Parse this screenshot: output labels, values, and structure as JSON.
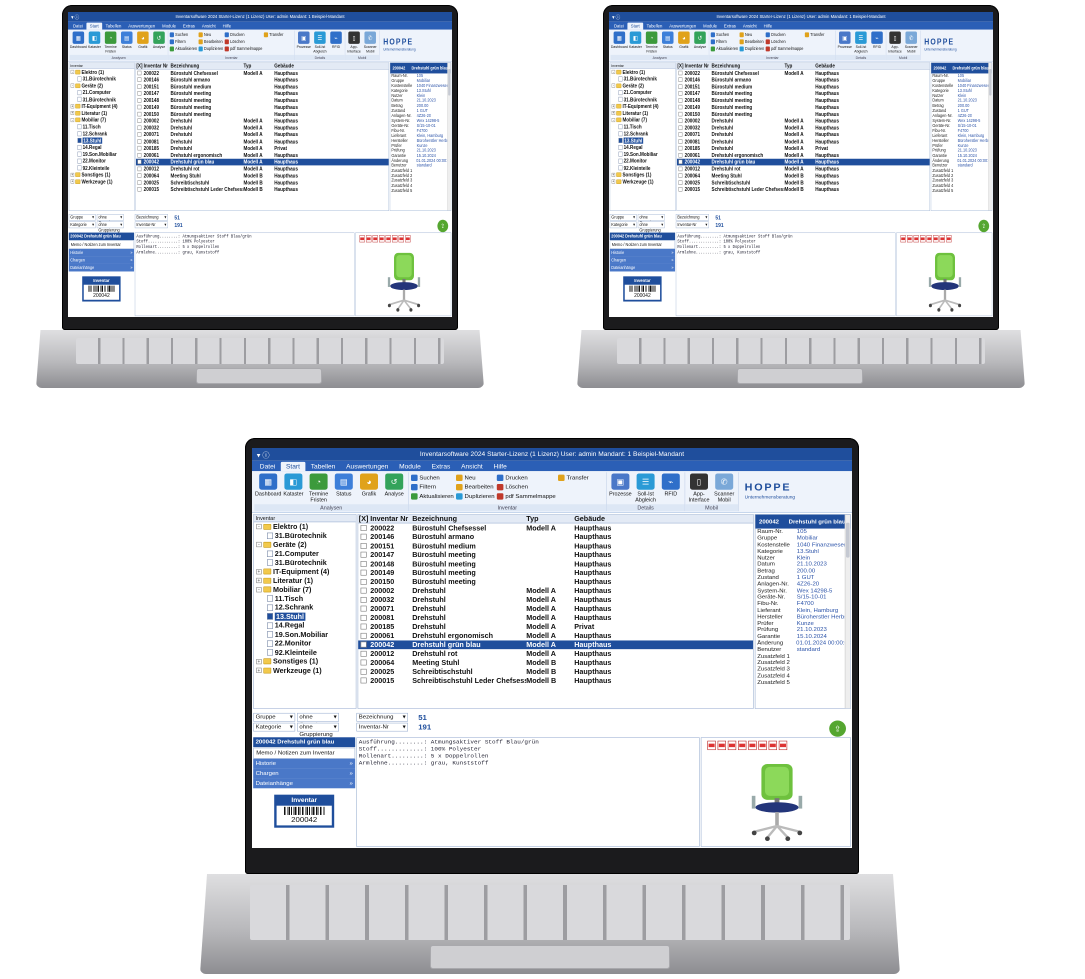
{
  "app": {
    "title": "Inventarsoftware 2024 Starter-Lizenz (1 Lizenz)   User: admin   Mandant: 1 Beispiel-Mandant",
    "menu": [
      "Datei",
      "Start",
      "Tabellen",
      "Auswertungen",
      "Module",
      "Extras",
      "Ansicht",
      "Hilfe"
    ],
    "active_menu": "Start"
  },
  "ribbon": {
    "analysen": {
      "label": "Analysen",
      "buttons": [
        "Dashboard",
        "Kataster",
        "Termine Fristen",
        "Status",
        "Grafik",
        "Analyse"
      ]
    },
    "inventar": {
      "label": "Inventar",
      "col1": [
        "Suchen",
        "Filtern",
        "Aktualisieren"
      ],
      "col2": [
        "Neu",
        "Bearbeiten",
        "Duplizieren"
      ],
      "col3": [
        "Drucken",
        "Löschen",
        "pdf Sammelmappe"
      ],
      "col4": [
        "Transfer"
      ]
    },
    "details": {
      "label": "Details",
      "buttons": [
        "Prozesse",
        "Soll-Ist Abgleich",
        "RFID"
      ]
    },
    "mobil": {
      "label": "Mobil",
      "buttons": [
        "App-Interface",
        "Scanner Mobil"
      ]
    },
    "brand": {
      "name": "HOPPE",
      "sub": "Unternehmensberatung"
    }
  },
  "tree": {
    "header": "Inventar",
    "nodes": [
      {
        "label": "Elektro  (1)",
        "level": 0,
        "type": "folder",
        "exp": "-"
      },
      {
        "label": "31.Bürotechnik",
        "level": 1,
        "type": "doc"
      },
      {
        "label": "Geräte  (2)",
        "level": 0,
        "type": "folder",
        "exp": "-"
      },
      {
        "label": "21.Computer",
        "level": 1,
        "type": "doc"
      },
      {
        "label": "31.Bürotechnik",
        "level": 1,
        "type": "doc"
      },
      {
        "label": "IT-Equipment  (4)",
        "level": 0,
        "type": "folder",
        "exp": "+"
      },
      {
        "label": "Literatur  (1)",
        "level": 0,
        "type": "folder",
        "exp": "+"
      },
      {
        "label": "Mobiliar  (7)",
        "level": 0,
        "type": "folder",
        "exp": "-"
      },
      {
        "label": "11.Tisch",
        "level": 1,
        "type": "doc"
      },
      {
        "label": "12.Schrank",
        "level": 1,
        "type": "doc"
      },
      {
        "label": "13.Stuhl",
        "level": 1,
        "type": "doc",
        "selected": true
      },
      {
        "label": "14.Regal",
        "level": 1,
        "type": "doc"
      },
      {
        "label": "19.Son.Mobiliar",
        "level": 1,
        "type": "doc"
      },
      {
        "label": "22.Monitor",
        "level": 1,
        "type": "doc"
      },
      {
        "label": "92.Kleinteile",
        "level": 1,
        "type": "doc"
      },
      {
        "label": "Sonstiges  (1)",
        "level": 0,
        "type": "folder",
        "exp": "+"
      },
      {
        "label": "Werkzeuge  (1)",
        "level": 0,
        "type": "folder",
        "exp": "+"
      }
    ]
  },
  "table": {
    "columns": [
      "[X]",
      "Inventar Nr",
      "Bezeichnung",
      "Typ",
      "Gebäude"
    ],
    "rows": [
      [
        "200022",
        "Bürostuhl Chefsessel",
        "Modell A",
        "Haupthaus"
      ],
      [
        "200146",
        "Bürostuhl armano",
        "",
        "Haupthaus"
      ],
      [
        "200151",
        "Bürostuhl medium",
        "",
        "Haupthaus"
      ],
      [
        "200147",
        "Bürostuhl meeting",
        "",
        "Haupthaus"
      ],
      [
        "200148",
        "Bürostuhl meeting",
        "",
        "Haupthaus"
      ],
      [
        "200149",
        "Bürostuhl meeting",
        "",
        "Haupthaus"
      ],
      [
        "200150",
        "Bürostuhl meeting",
        "",
        "Haupthaus"
      ],
      [
        "200002",
        "Drehstuhl",
        "Modell A",
        "Haupthaus"
      ],
      [
        "200032",
        "Drehstuhl",
        "Modell A",
        "Haupthaus"
      ],
      [
        "200071",
        "Drehstuhl",
        "Modell A",
        "Haupthaus"
      ],
      [
        "200081",
        "Drehstuhl",
        "Modell A",
        "Haupthaus"
      ],
      [
        "200185",
        "Drehstuhl",
        "Modell A",
        "Privat"
      ],
      [
        "200061",
        "Drehstuhl ergonomisch",
        "Modell A",
        "Haupthaus"
      ],
      [
        "200042",
        "Drehstuhl grün blau",
        "Modell A",
        "Haupthaus"
      ],
      [
        "200012",
        "Drehstuhl rot",
        "Modell A",
        "Haupthaus"
      ],
      [
        "200064",
        "Meeting Stuhl",
        "Modell B",
        "Haupthaus"
      ],
      [
        "200025",
        "Schreibtischstuhl",
        "Modell B",
        "Haupthaus"
      ],
      [
        "200015",
        "Schreibtischstuhl Leder Chefsessel",
        "Modell B",
        "Haupthaus"
      ]
    ],
    "selected_index": 13
  },
  "detail": {
    "id": "200042",
    "name": "Drehstuhl grün blau",
    "fields": [
      [
        "Raum-Nr.",
        "105"
      ],
      [
        "Gruppe",
        "Mobiliar"
      ],
      [
        "Kostenstelle",
        "1040 Finanzwesen"
      ],
      [
        "Kategorie",
        "13.Stuhl"
      ],
      [
        "Nutzer",
        "Klein"
      ],
      [
        "Datum",
        "21.10.2023"
      ],
      [
        "Betrag",
        "200.00"
      ],
      [
        "Zustand",
        "1 GUT"
      ],
      [
        "Anlagen-Nr.",
        "4Z26-20"
      ],
      [
        "System-Nr.",
        "Wex 14298-5"
      ],
      [
        "Geräte-Nr.",
        "S/15-10-01"
      ],
      [
        "Fibu-Nr.",
        "F4700"
      ],
      [
        "Lieferant",
        "Klein, Hamburg"
      ],
      [
        "Hersteller",
        "Büroherstler Herbst"
      ],
      [
        "Prüfer",
        "Kunze"
      ],
      [
        "Prüfung",
        "21.10.2023"
      ],
      [
        "Garantie",
        "15.10.2024"
      ],
      [
        "Änderung",
        "01.01.2024 00:00:00"
      ],
      [
        "Benutzer",
        "standard"
      ],
      [
        "Zusatzfeld 1",
        ""
      ],
      [
        "Zusatzfeld 2",
        ""
      ],
      [
        "Zusatzfeld 3",
        ""
      ],
      [
        "Zusatzfeld 4",
        ""
      ],
      [
        "Zusatzfeld 5",
        ""
      ]
    ]
  },
  "filters": {
    "row1": {
      "field": "Gruppe",
      "group": "ohne Gruppierung"
    },
    "row2": {
      "field": "Kategorie",
      "group": "ohne Gruppierung"
    },
    "sort1": "Bezeichnung",
    "sort2": "Inventar-Nr",
    "count1": "51",
    "count2": "191"
  },
  "bottom": {
    "header": "200042 Drehstuhl grün blau",
    "items": [
      "Memo / Notizen zum Inventar",
      "Historie",
      "Chargen",
      "Dateianhänge"
    ],
    "barcode_title": "Inventar",
    "barcode_value": "200042",
    "memo": [
      "Ausführung........: Atmungsaktiver Stoff Blau/grün",
      "Stoff.............: 100% Polyester",
      "Rollenart.........: 5 x Doppelrollen",
      "Armlehne..........: grau, Kunststoff"
    ]
  }
}
